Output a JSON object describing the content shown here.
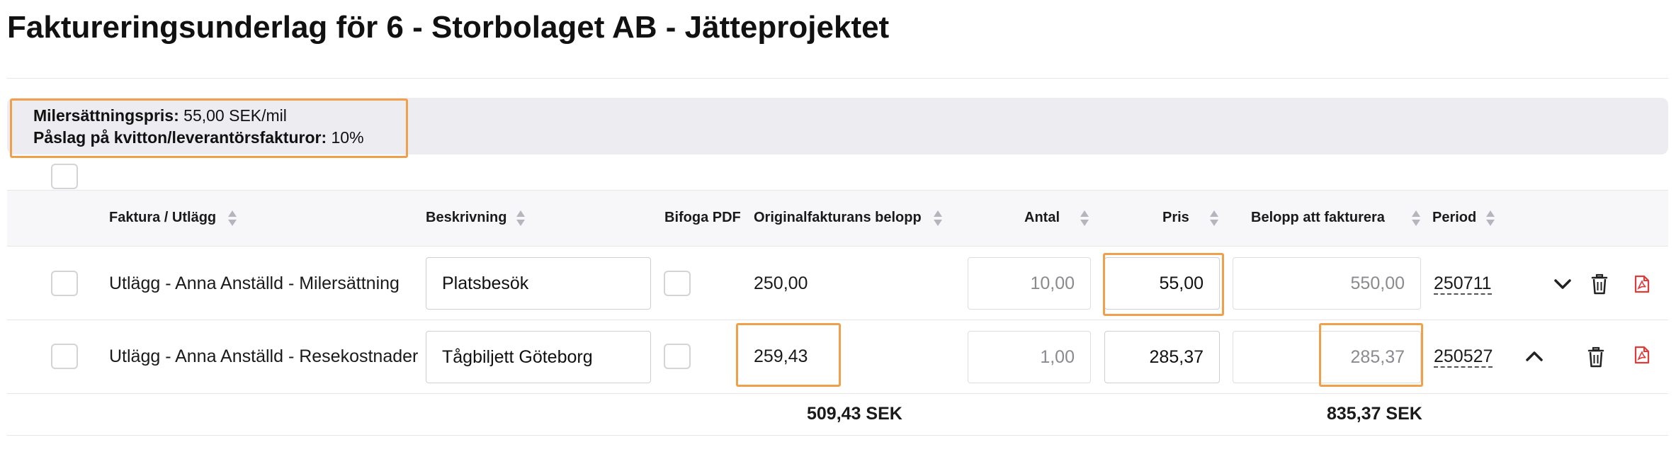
{
  "page": {
    "title": "Faktureringsunderlag för 6 - Storbolaget AB - Jätteprojektet"
  },
  "info": {
    "mileage_label": "Milersättningspris:",
    "mileage_value": " 55,00 SEK/mil",
    "markup_label": "Påslag på kvitton/leverantörsfakturor:",
    "markup_value": " 10%"
  },
  "table": {
    "headers": {
      "invoice": "Faktura / Utlägg",
      "description": "Beskrivning",
      "attach_pdf": "Bifoga PDF",
      "original_amount": "Originalfakturans belopp",
      "quantity": "Antal",
      "price": "Pris",
      "amount_to_invoice": "Belopp att fakturera",
      "period": "Period"
    },
    "rows": [
      {
        "invoice": "Utlägg - Anna Anställd - Milersättning",
        "description": "Platsbesök",
        "original_amount": "250,00",
        "quantity": "10,00",
        "price": "55,00",
        "amount_to_invoice": "550,00",
        "period": "250711",
        "expand_icon": "chevron-down-icon"
      },
      {
        "invoice": "Utlägg - Anna Anställd - Resekostnader",
        "description": "Tågbiljett Göteborg",
        "original_amount": "259,43",
        "quantity": "1,00",
        "price": "285,37",
        "amount_to_invoice": "285,37",
        "period": "250527",
        "expand_icon": "chevron-up-icon"
      }
    ],
    "totals": {
      "original_amount": "509,43 SEK",
      "amount_to_invoice": "835,37 SEK"
    }
  },
  "colors": {
    "highlight": "#f0a04b",
    "pdf_icon": "#e03a3a",
    "info_bg": "#ececf1"
  }
}
